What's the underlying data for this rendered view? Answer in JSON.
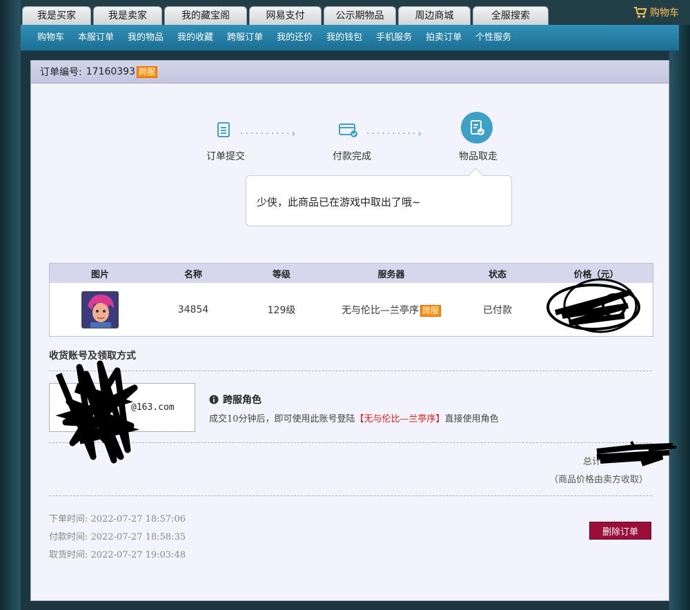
{
  "top_tabs": [
    "我是买家",
    "我是卖家",
    "我的藏宝阁",
    "网易支付",
    "公示期物品",
    "周边商城",
    "全服搜索"
  ],
  "cart_label": "购物车",
  "sub_nav": [
    "购物车",
    "本服订单",
    "我的物品",
    "我的收藏",
    "跨服订单",
    "我的还价",
    "我的钱包",
    "手机服务",
    "拍卖订单",
    "个性服务"
  ],
  "order": {
    "number_label": "订单编号:",
    "number": "17160393",
    "badge": "跨服"
  },
  "steps": {
    "items": [
      "订单提交",
      "付款完成",
      "物品取走"
    ],
    "message": "少侠，此商品已在游戏中取出了哦~"
  },
  "table": {
    "headers": [
      "图片",
      "名称",
      "等级",
      "服务器",
      "状态",
      "价格（元）"
    ],
    "row": {
      "name": "34854",
      "level": "129级",
      "server": "无与伦比—兰亭序",
      "server_badge": "跨服",
      "status": "已付款"
    }
  },
  "receive": {
    "title": "收货账号及领取方式",
    "account_visible": "@163.com",
    "cross_title": "跨服角色",
    "desc_prefix": "成交10分钟后，即可使用此账号登陆",
    "desc_server": "【无与伦比—兰亭序】",
    "desc_suffix": "直接使用角色"
  },
  "total": {
    "label": "总计",
    "note": "（商品价格由卖方收取）"
  },
  "times": {
    "order": "下单时间: 2022-07-27 18:57:06",
    "pay": "付款时间: 2022-07-27 18:58:35",
    "take": "取货时间: 2022-07-27 19:03:48"
  },
  "delete_button": "删除订单",
  "colors": {
    "accent_blue": "#3da0c7",
    "badge_orange": "#ff8a00",
    "delete_red": "#9b0e3a",
    "cart_gold": "#ffc54d"
  }
}
